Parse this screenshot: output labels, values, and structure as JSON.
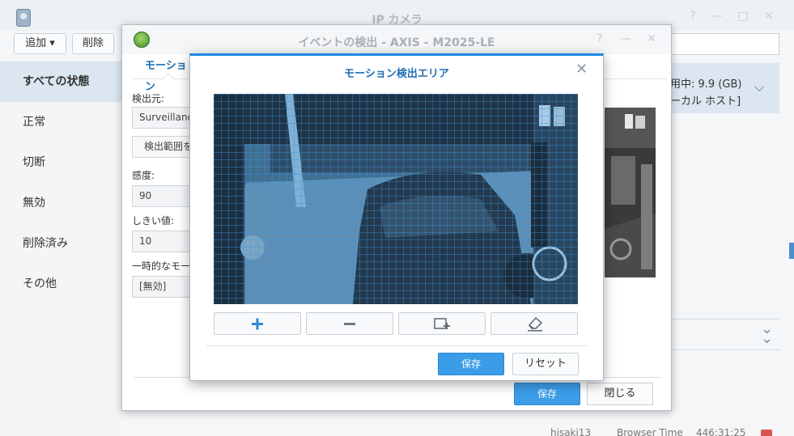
{
  "main": {
    "title": "IP カメラ",
    "toolbar": {
      "add_label": "追加 ▾",
      "delete_label": "削除"
    },
    "sidebar": {
      "items": [
        {
          "label": "すべての状態"
        },
        {
          "label": "正常"
        },
        {
          "label": "切断"
        },
        {
          "label": "無効"
        },
        {
          "label": "削除済み"
        },
        {
          "label": "その他"
        }
      ]
    },
    "right_panel": {
      "line1": "用中: 9.9 (GB)",
      "line2": "ーカル ホスト]"
    },
    "bottom_row": {
      "user": "hisaki13",
      "browser": "Browser Time",
      "time": "446:31:25"
    }
  },
  "event_dialog": {
    "title": "イベントの検出 - AXIS - M2025-LE",
    "tab_label": "モーション",
    "source_label": "検出元:",
    "source_value": "Surveillance Station",
    "area_button": "検出範囲を設定",
    "sensitivity_label": "感度:",
    "sensitivity_value": "90",
    "threshold_label": "しきい値:",
    "threshold_value": "10",
    "temp_label": "一時的なモーション:",
    "temp_value": "[無効]",
    "save_label": "保存",
    "close_label": "閉じる"
  },
  "motion_dialog": {
    "title": "モーション検出エリア",
    "tools": [
      {
        "icon": "plus-icon"
      },
      {
        "icon": "minus-icon"
      },
      {
        "icon": "add-region-icon"
      },
      {
        "icon": "eraser-icon"
      }
    ],
    "save_label": "保存",
    "reset_label": "リセット"
  },
  "colors": {
    "accent_blue": "#3b9de8",
    "title_blue": "#1f6eb0",
    "sidebar_active": "#dbe6f0",
    "grid_overlay": "#4aa3e8"
  }
}
